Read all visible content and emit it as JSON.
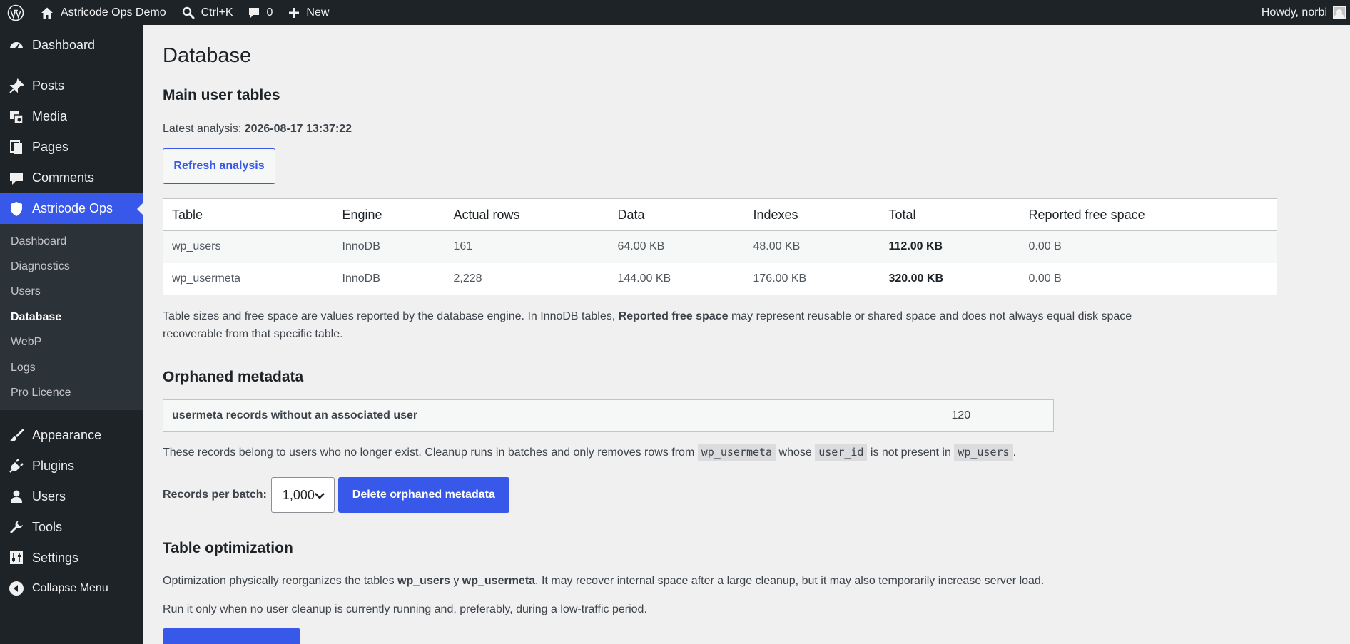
{
  "adminbar": {
    "site_name": "Astricode Ops Demo",
    "search_shortcut": "Ctrl+K",
    "comments_count": "0",
    "new_label": "New",
    "greeting": "Howdy, norbi"
  },
  "sidebar": {
    "items_top": [
      {
        "label": "Dashboard",
        "icon": "dashboard-icon"
      }
    ],
    "items_mid": [
      {
        "label": "Posts",
        "icon": "pin-icon"
      },
      {
        "label": "Media",
        "icon": "media-icon"
      },
      {
        "label": "Pages",
        "icon": "pages-icon"
      },
      {
        "label": "Comments",
        "icon": "comment-icon"
      },
      {
        "label": "Astricode Ops",
        "icon": "shield-icon"
      }
    ],
    "submenu": [
      {
        "label": "Dashboard"
      },
      {
        "label": "Diagnostics"
      },
      {
        "label": "Users"
      },
      {
        "label": "Database"
      },
      {
        "label": "WebP"
      },
      {
        "label": "Logs"
      },
      {
        "label": "Pro Licence"
      }
    ],
    "items_bottom": [
      {
        "label": "Appearance",
        "icon": "brush-icon"
      },
      {
        "label": "Plugins",
        "icon": "plug-icon"
      },
      {
        "label": "Users",
        "icon": "user-icon"
      },
      {
        "label": "Tools",
        "icon": "wrench-icon"
      },
      {
        "label": "Settings",
        "icon": "sliders-icon"
      },
      {
        "label": "Collapse Menu",
        "icon": "collapse-icon"
      }
    ]
  },
  "page": {
    "title": "Database",
    "main_tables_heading": "Main user tables",
    "latest_analysis_label": "Latest analysis:",
    "latest_analysis_value": "2026-08-17 13:37:22",
    "refresh_button": "Refresh analysis",
    "table": {
      "headers": [
        "Table",
        "Engine",
        "Actual rows",
        "Data",
        "Indexes",
        "Total",
        "Reported free space"
      ],
      "rows": [
        [
          "wp_users",
          "InnoDB",
          "161",
          "64.00 KB",
          "48.00 KB",
          "112.00 KB",
          "0.00 B"
        ],
        [
          "wp_usermeta",
          "InnoDB",
          "2,228",
          "144.00 KB",
          "176.00 KB",
          "320.00 KB",
          "0.00 B"
        ]
      ]
    },
    "note_part1": "Table sizes and free space are values reported by the database engine. In InnoDB tables,",
    "note_bold": "Reported free space",
    "note_part2": "may represent reusable or shared space and does not always equal disk space",
    "note_line2": "recoverable from that specific table.",
    "orphan_heading": "Orphaned metadata",
    "orphan_label": "usermeta records without an associated user",
    "orphan_count": "120",
    "orphan_desc_1": "These records belong to users who no longer exist. Cleanup runs in batches and only removes rows from",
    "orphan_code_1": "wp_usermeta",
    "orphan_desc_2": "whose",
    "orphan_code_2": "user_id",
    "orphan_desc_3": "is not present in",
    "orphan_code_3": "wp_users",
    "orphan_desc_4": ".",
    "batch_label": "Records per batch:",
    "batch_value": "1,000",
    "delete_button": "Delete orphaned metadata",
    "optimization_heading": "Table optimization",
    "opt_p1_a": "Optimization physically reorganizes the tables",
    "opt_p1_b": "wp_users",
    "opt_p1_c": "y",
    "opt_p1_d": "wp_usermeta",
    "opt_p1_e": ". It may recover internal space after a large cleanup, but it may also temporarily increase server load.",
    "opt_p2": "Run it only when no user cleanup is currently running and, preferably, during a low-traffic period."
  },
  "colors": {
    "accent": "#3858e9",
    "sidebar_bg": "#1d2327",
    "page_bg": "#f0f0f1"
  }
}
